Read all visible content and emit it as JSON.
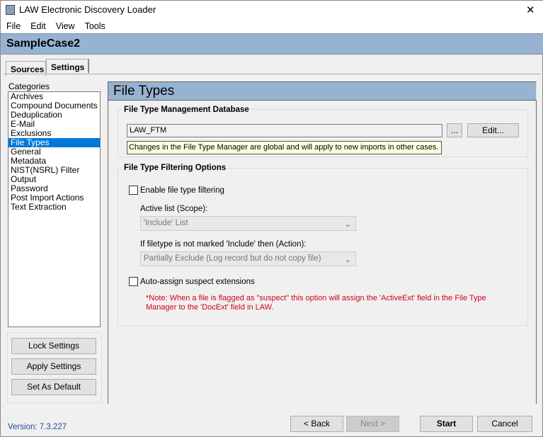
{
  "window": {
    "title": "LAW Electronic Discovery Loader",
    "close": "✕"
  },
  "menu": [
    "File",
    "Edit",
    "View",
    "Tools"
  ],
  "case_name": "SampleCase2",
  "tabs": [
    "Sources",
    "Settings"
  ],
  "categories": {
    "label": "Categories",
    "items": [
      "Archives",
      "Compound Documents",
      "Deduplication",
      "E-Mail",
      "Exclusions",
      "File Types",
      "General",
      "Metadata",
      "NIST(NSRL) Filter",
      "Output",
      "Password",
      "Post Import Actions",
      "Text Extraction"
    ],
    "selected": "File Types"
  },
  "side_buttons": [
    "Lock Settings",
    "Apply Settings",
    "Set As Default"
  ],
  "panel": {
    "title": "File Types",
    "ftm": {
      "title": "File Type Management Database",
      "value": "LAW_FTM",
      "browse": "...",
      "edit": "Edit...",
      "note": "Changes in the File Type Manager are global and will apply to new imports in other cases."
    },
    "filter": {
      "title": "File Type Filtering Options",
      "enable": "Enable file type filtering",
      "enable_checked": false,
      "active_label": "Active list (Scope):",
      "active_value": "'Include' List",
      "action_label": "If filetype is not marked 'Include' then (Action):",
      "action_value": "Partially Exclude (Log record but do not copy file)",
      "auto": "Auto-assign suspect extensions",
      "auto_checked": false,
      "note": "*Note: When a file is flagged as \"suspect\" this option will assign the 'ActiveExt' field in the File Type Manager to the 'DocExt' field in LAW.",
      "note_color": "#d0021b"
    }
  },
  "footer": {
    "version": "Version: 7.3.227",
    "back": "< Back",
    "next": "Next >",
    "start": "Start",
    "cancel": "Cancel"
  }
}
